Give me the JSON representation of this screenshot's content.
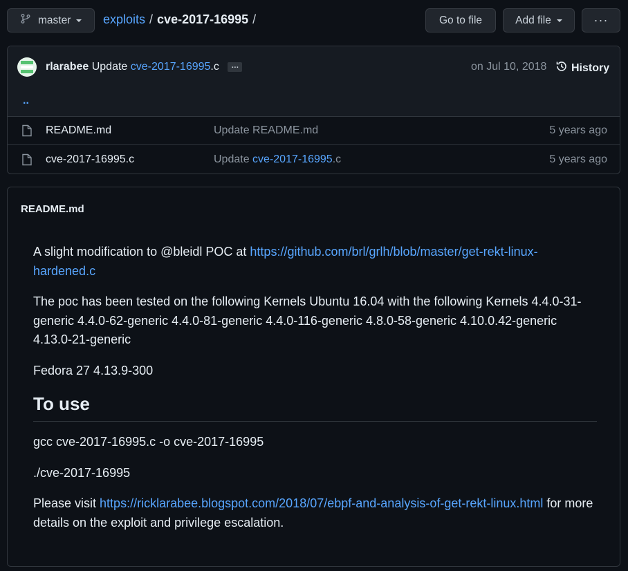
{
  "header": {
    "branch": "master",
    "breadcrumb_repo": "exploits",
    "breadcrumb_sep": "/",
    "breadcrumb_dir": "cve-2017-16995",
    "breadcrumb_trail": "/",
    "goto_file": "Go to file",
    "add_file": "Add file",
    "more": "···"
  },
  "commit": {
    "author": "rlarabee",
    "msg_prefix": "Update",
    "msg_link": "cve-2017-16995",
    "msg_suffix": ".c",
    "ellipsis": "…",
    "date": "on Jul 10, 2018",
    "history": "History"
  },
  "files": {
    "updir": "..",
    "rows": [
      {
        "name": "README.md",
        "msg": "Update README.md",
        "msg_link": "",
        "msg_suffix": "",
        "age": "5 years ago"
      },
      {
        "name": "cve-2017-16995.c",
        "msg": "Update ",
        "msg_link": "cve-2017-16995",
        "msg_suffix": ".c",
        "age": "5 years ago"
      }
    ]
  },
  "readme": {
    "title": "README.md",
    "p1_text": "A slight modification to @bleidl POC at ",
    "p1_link": "https://github.com/brl/grlh/blob/master/get-rekt-linux-hardened.c",
    "p2": "The poc has been tested on the following Kernels Ubuntu 16.04 with the following Kernels 4.4.0-31-generic 4.4.0-62-generic 4.4.0-81-generic 4.4.0-116-generic 4.8.0-58-generic 4.10.0.42-generic 4.13.0-21-generic",
    "p3": "Fedora 27 4.13.9-300",
    "h2": "To use",
    "p4": "gcc cve-2017-16995.c -o cve-2017-16995",
    "p5": "./cve-2017-16995",
    "p6_text": "Please visit ",
    "p6_link": "https://ricklarabee.blogspot.com/2018/07/ebpf-and-analysis-of-get-rekt-linux.html",
    "p6_suffix": " for more details on the exploit and privilege escalation."
  },
  "colors": {
    "background": "#0d1117",
    "panel": "#161b22",
    "border": "#30363d",
    "link": "#58a6ff",
    "muted": "#8b949e"
  }
}
